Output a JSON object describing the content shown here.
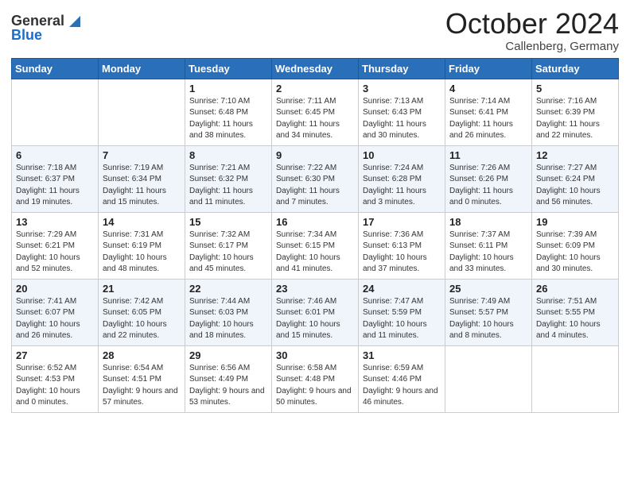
{
  "header": {
    "logo_general": "General",
    "logo_blue": "Blue",
    "month": "October 2024",
    "location": "Callenberg, Germany"
  },
  "weekdays": [
    "Sunday",
    "Monday",
    "Tuesday",
    "Wednesday",
    "Thursday",
    "Friday",
    "Saturday"
  ],
  "weeks": [
    [
      {
        "day": "",
        "sunrise": "",
        "sunset": "",
        "daylight": ""
      },
      {
        "day": "",
        "sunrise": "",
        "sunset": "",
        "daylight": ""
      },
      {
        "day": "1",
        "sunrise": "Sunrise: 7:10 AM",
        "sunset": "Sunset: 6:48 PM",
        "daylight": "Daylight: 11 hours and 38 minutes."
      },
      {
        "day": "2",
        "sunrise": "Sunrise: 7:11 AM",
        "sunset": "Sunset: 6:45 PM",
        "daylight": "Daylight: 11 hours and 34 minutes."
      },
      {
        "day": "3",
        "sunrise": "Sunrise: 7:13 AM",
        "sunset": "Sunset: 6:43 PM",
        "daylight": "Daylight: 11 hours and 30 minutes."
      },
      {
        "day": "4",
        "sunrise": "Sunrise: 7:14 AM",
        "sunset": "Sunset: 6:41 PM",
        "daylight": "Daylight: 11 hours and 26 minutes."
      },
      {
        "day": "5",
        "sunrise": "Sunrise: 7:16 AM",
        "sunset": "Sunset: 6:39 PM",
        "daylight": "Daylight: 11 hours and 22 minutes."
      }
    ],
    [
      {
        "day": "6",
        "sunrise": "Sunrise: 7:18 AM",
        "sunset": "Sunset: 6:37 PM",
        "daylight": "Daylight: 11 hours and 19 minutes."
      },
      {
        "day": "7",
        "sunrise": "Sunrise: 7:19 AM",
        "sunset": "Sunset: 6:34 PM",
        "daylight": "Daylight: 11 hours and 15 minutes."
      },
      {
        "day": "8",
        "sunrise": "Sunrise: 7:21 AM",
        "sunset": "Sunset: 6:32 PM",
        "daylight": "Daylight: 11 hours and 11 minutes."
      },
      {
        "day": "9",
        "sunrise": "Sunrise: 7:22 AM",
        "sunset": "Sunset: 6:30 PM",
        "daylight": "Daylight: 11 hours and 7 minutes."
      },
      {
        "day": "10",
        "sunrise": "Sunrise: 7:24 AM",
        "sunset": "Sunset: 6:28 PM",
        "daylight": "Daylight: 11 hours and 3 minutes."
      },
      {
        "day": "11",
        "sunrise": "Sunrise: 7:26 AM",
        "sunset": "Sunset: 6:26 PM",
        "daylight": "Daylight: 11 hours and 0 minutes."
      },
      {
        "day": "12",
        "sunrise": "Sunrise: 7:27 AM",
        "sunset": "Sunset: 6:24 PM",
        "daylight": "Daylight: 10 hours and 56 minutes."
      }
    ],
    [
      {
        "day": "13",
        "sunrise": "Sunrise: 7:29 AM",
        "sunset": "Sunset: 6:21 PM",
        "daylight": "Daylight: 10 hours and 52 minutes."
      },
      {
        "day": "14",
        "sunrise": "Sunrise: 7:31 AM",
        "sunset": "Sunset: 6:19 PM",
        "daylight": "Daylight: 10 hours and 48 minutes."
      },
      {
        "day": "15",
        "sunrise": "Sunrise: 7:32 AM",
        "sunset": "Sunset: 6:17 PM",
        "daylight": "Daylight: 10 hours and 45 minutes."
      },
      {
        "day": "16",
        "sunrise": "Sunrise: 7:34 AM",
        "sunset": "Sunset: 6:15 PM",
        "daylight": "Daylight: 10 hours and 41 minutes."
      },
      {
        "day": "17",
        "sunrise": "Sunrise: 7:36 AM",
        "sunset": "Sunset: 6:13 PM",
        "daylight": "Daylight: 10 hours and 37 minutes."
      },
      {
        "day": "18",
        "sunrise": "Sunrise: 7:37 AM",
        "sunset": "Sunset: 6:11 PM",
        "daylight": "Daylight: 10 hours and 33 minutes."
      },
      {
        "day": "19",
        "sunrise": "Sunrise: 7:39 AM",
        "sunset": "Sunset: 6:09 PM",
        "daylight": "Daylight: 10 hours and 30 minutes."
      }
    ],
    [
      {
        "day": "20",
        "sunrise": "Sunrise: 7:41 AM",
        "sunset": "Sunset: 6:07 PM",
        "daylight": "Daylight: 10 hours and 26 minutes."
      },
      {
        "day": "21",
        "sunrise": "Sunrise: 7:42 AM",
        "sunset": "Sunset: 6:05 PM",
        "daylight": "Daylight: 10 hours and 22 minutes."
      },
      {
        "day": "22",
        "sunrise": "Sunrise: 7:44 AM",
        "sunset": "Sunset: 6:03 PM",
        "daylight": "Daylight: 10 hours and 18 minutes."
      },
      {
        "day": "23",
        "sunrise": "Sunrise: 7:46 AM",
        "sunset": "Sunset: 6:01 PM",
        "daylight": "Daylight: 10 hours and 15 minutes."
      },
      {
        "day": "24",
        "sunrise": "Sunrise: 7:47 AM",
        "sunset": "Sunset: 5:59 PM",
        "daylight": "Daylight: 10 hours and 11 minutes."
      },
      {
        "day": "25",
        "sunrise": "Sunrise: 7:49 AM",
        "sunset": "Sunset: 5:57 PM",
        "daylight": "Daylight: 10 hours and 8 minutes."
      },
      {
        "day": "26",
        "sunrise": "Sunrise: 7:51 AM",
        "sunset": "Sunset: 5:55 PM",
        "daylight": "Daylight: 10 hours and 4 minutes."
      }
    ],
    [
      {
        "day": "27",
        "sunrise": "Sunrise: 6:52 AM",
        "sunset": "Sunset: 4:53 PM",
        "daylight": "Daylight: 10 hours and 0 minutes."
      },
      {
        "day": "28",
        "sunrise": "Sunrise: 6:54 AM",
        "sunset": "Sunset: 4:51 PM",
        "daylight": "Daylight: 9 hours and 57 minutes."
      },
      {
        "day": "29",
        "sunrise": "Sunrise: 6:56 AM",
        "sunset": "Sunset: 4:49 PM",
        "daylight": "Daylight: 9 hours and 53 minutes."
      },
      {
        "day": "30",
        "sunrise": "Sunrise: 6:58 AM",
        "sunset": "Sunset: 4:48 PM",
        "daylight": "Daylight: 9 hours and 50 minutes."
      },
      {
        "day": "31",
        "sunrise": "Sunrise: 6:59 AM",
        "sunset": "Sunset: 4:46 PM",
        "daylight": "Daylight: 9 hours and 46 minutes."
      },
      {
        "day": "",
        "sunrise": "",
        "sunset": "",
        "daylight": ""
      },
      {
        "day": "",
        "sunrise": "",
        "sunset": "",
        "daylight": ""
      }
    ]
  ]
}
